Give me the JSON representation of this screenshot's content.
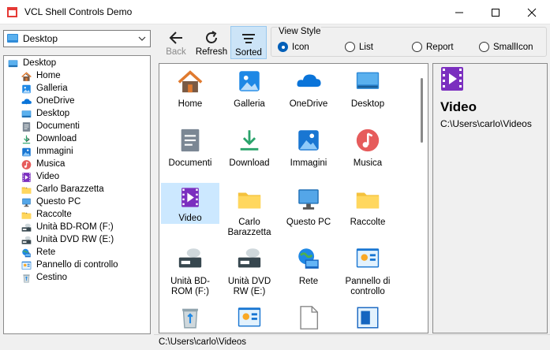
{
  "window": {
    "title": "VCL Shell Controls Demo"
  },
  "combo": {
    "value": "Desktop"
  },
  "tree": {
    "items": [
      {
        "label": "Desktop",
        "icon": "desktop-icon",
        "expand": false
      },
      {
        "label": "Home",
        "icon": "home-icon",
        "expand": true
      },
      {
        "label": "Galleria",
        "icon": "gallery-icon",
        "expand": false
      },
      {
        "label": "OneDrive",
        "icon": "onedrive-icon",
        "expand": true
      },
      {
        "label": "Desktop",
        "icon": "desktop-icon",
        "expand": true
      },
      {
        "label": "Documenti",
        "icon": "documents-icon",
        "expand": true
      },
      {
        "label": "Download",
        "icon": "download-icon",
        "expand": true
      },
      {
        "label": "Immagini",
        "icon": "pictures-icon",
        "expand": true
      },
      {
        "label": "Musica",
        "icon": "music-icon",
        "expand": true
      },
      {
        "label": "Video",
        "icon": "video-icon",
        "expand": true
      },
      {
        "label": "Carlo Barazzetta",
        "icon": "folder-icon",
        "expand": true
      },
      {
        "label": "Questo PC",
        "icon": "computer-icon",
        "expand": true
      },
      {
        "label": "Raccolte",
        "icon": "folder-icon",
        "expand": true
      },
      {
        "label": "Unità BD-ROM (F:)",
        "icon": "drive-icon",
        "expand": true
      },
      {
        "label": "Unità DVD RW (E:)",
        "icon": "drive-icon",
        "expand": true
      },
      {
        "label": "Rete",
        "icon": "network-icon",
        "expand": true
      },
      {
        "label": "Pannello di controllo",
        "icon": "control-panel-icon",
        "expand": true
      },
      {
        "label": "Cestino",
        "icon": "recycle-bin-icon",
        "expand": false
      }
    ]
  },
  "toolbar": {
    "back": "Back",
    "refresh": "Refresh",
    "sorted": "Sorted"
  },
  "view_style": {
    "title": "View Style",
    "options": [
      "Icon",
      "List",
      "Report",
      "SmallIcon"
    ],
    "selected": "Icon"
  },
  "list": {
    "items": [
      {
        "label": "Home"
      },
      {
        "label": "Galleria"
      },
      {
        "label": "OneDrive"
      },
      {
        "label": "Desktop"
      },
      {
        "label": "Documenti"
      },
      {
        "label": "Download"
      },
      {
        "label": "Immagini"
      },
      {
        "label": "Musica"
      },
      {
        "label": "Video"
      },
      {
        "label": "Carlo Barazzetta"
      },
      {
        "label": "Questo PC"
      },
      {
        "label": "Raccolte"
      },
      {
        "label": "Unità BD-ROM (F:)"
      },
      {
        "label": "Unità DVD RW (E:)"
      },
      {
        "label": "Rete"
      },
      {
        "label": "Pannello di controllo"
      },
      {
        "label": ""
      },
      {
        "label": ""
      },
      {
        "label": ""
      },
      {
        "label": ""
      }
    ],
    "selected": "Video"
  },
  "preview": {
    "title": "Video",
    "path": "C:\\Users\\carlo\\Videos"
  },
  "status": {
    "path": "C:\\Users\\carlo\\Videos"
  },
  "colors": {
    "accent": "#005fb8",
    "selection": "#cce8ff",
    "toolbar_pressed": "#cce4f7"
  }
}
